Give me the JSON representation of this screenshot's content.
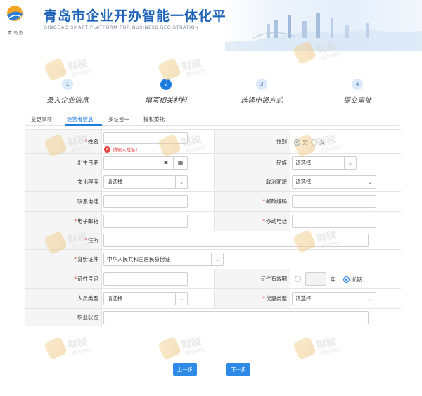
{
  "header": {
    "title": "青岛市企业开办智能一体化平台",
    "subtitle": "QINGDAO SMART PLATFORM FOR BUSINESS REGISTRATION",
    "logo_caption": "青 岛 办"
  },
  "steps": [
    {
      "num": "1",
      "label": "录入企业信息",
      "active": false
    },
    {
      "num": "2",
      "label": "填写相关材料",
      "active": true
    },
    {
      "num": "3",
      "label": "选择申报方式",
      "active": false
    },
    {
      "num": "4",
      "label": "提交审批",
      "active": false
    }
  ],
  "tabs": [
    "变更事项",
    "经营者信息",
    "多证合一",
    "授权委托"
  ],
  "active_tab": "经营者信息",
  "form": {
    "name_label": "姓名",
    "name_error": "请输入姓名！",
    "gender_label": "性别",
    "gender_options": [
      "男",
      "女"
    ],
    "gender_selected": "男",
    "birth_label": "出生日期",
    "ethnic_label": "民族",
    "ethnic_value": "请选择",
    "education_label": "文化程度",
    "education_value": "请选择",
    "political_label": "政治面貌",
    "political_value": "请选择",
    "phone_label": "联系电话",
    "postcode_label": "邮政编码",
    "email_label": "电子邮箱",
    "mobile_label": "移动电话",
    "address_label": "住所",
    "idtype_label": "身份证件",
    "idtype_value": "中华人民共和国居民身份证",
    "idno_label": "证件号码",
    "validity_label": "证件有效期",
    "validity_year_unit": "年",
    "validity_long_label": "长期",
    "persontype_label": "人员类型",
    "persontype_value": "请选择",
    "discount_label": "优惠类型",
    "discount_value": "请选择",
    "job_label": "职业状况"
  },
  "buttons": {
    "prev": "上一步",
    "next": "下一步"
  },
  "watermark": {
    "text": "财税",
    "sub": "联合耕拓"
  },
  "colors": {
    "brand": "#1d63b8",
    "accent": "#1d7ce0",
    "error": "#e6423b"
  }
}
